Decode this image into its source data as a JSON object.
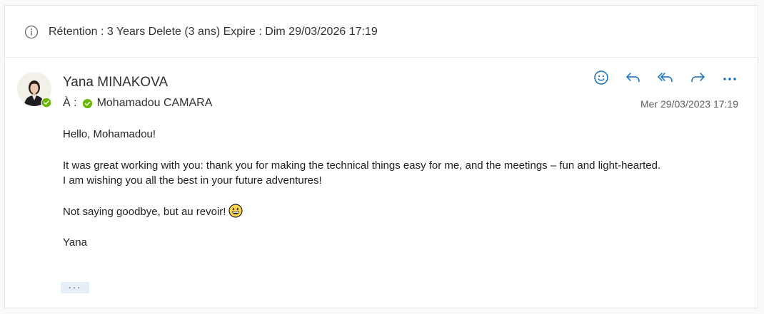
{
  "retention": {
    "icon": "info-icon",
    "text": "Rétention : 3 Years Delete (3 ans) Expire : Dim 29/03/2026 17:19"
  },
  "message": {
    "sender": {
      "name": "Yana MINAKOVA",
      "avatar_icon": "avatar",
      "presence": "available",
      "presence_color": "#6bb700"
    },
    "to": {
      "label": "À :",
      "recipient": "Mohamadou CAMARA",
      "recipient_presence_color": "#6bb700"
    },
    "date": "Mer 29/03/2023 17:19",
    "actions": [
      {
        "name": "reaction",
        "icon": "smiley-icon"
      },
      {
        "name": "reply",
        "icon": "reply-icon"
      },
      {
        "name": "reply-all",
        "icon": "reply-all-icon"
      },
      {
        "name": "forward",
        "icon": "forward-icon"
      },
      {
        "name": "more",
        "icon": "more-icon"
      }
    ],
    "body": {
      "greeting": "Hello, Mohamadou!",
      "paragraph1_line1": "It was great working with you: thank you for making the technical things easy for me, and the meetings – fun and light-hearted.",
      "paragraph1_line2": "I am wishing you all the best in your future adventures!",
      "closing": "Not saying goodbye, but au revoir!",
      "closing_emoji": "grinning-face-emoji",
      "signature": "Yana"
    },
    "expand_label": "···"
  },
  "colors": {
    "accent": "#0f6cbd",
    "text": "#323130",
    "muted": "#605e5c",
    "presence": "#6bb700"
  }
}
